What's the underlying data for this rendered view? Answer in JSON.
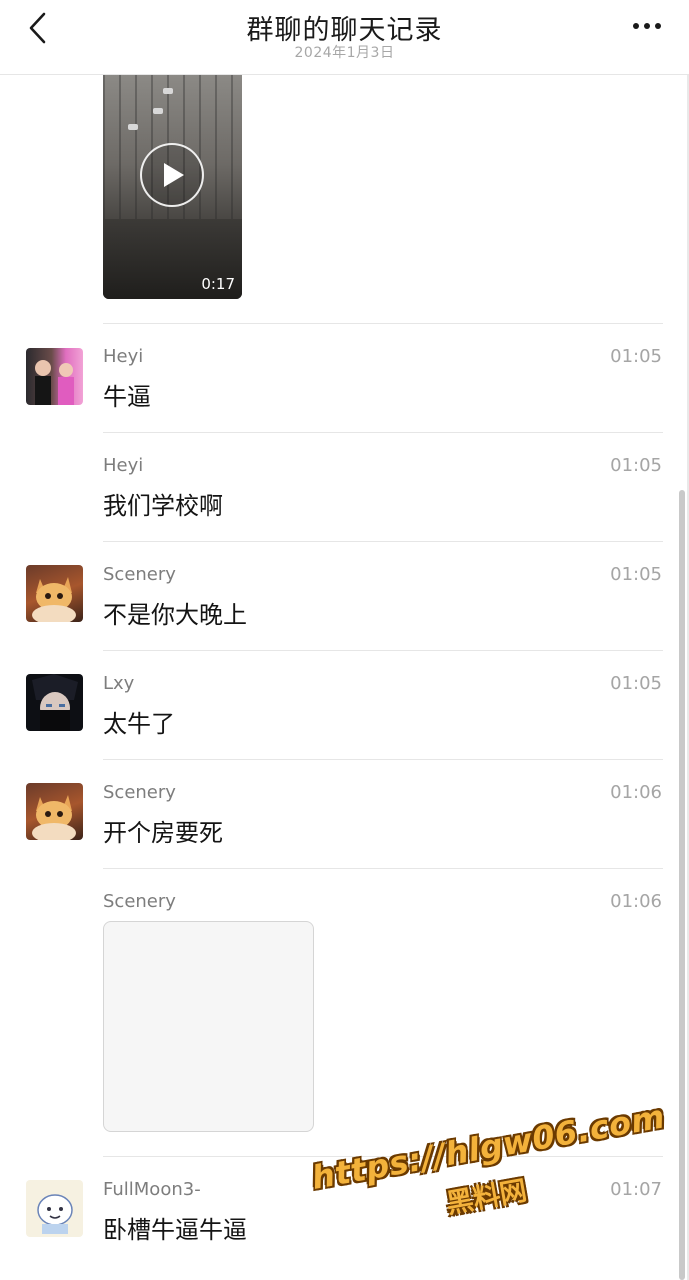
{
  "header": {
    "title": "群聊的聊天记录",
    "date": "2024年1月3日",
    "back_icon": "chevron-left-icon",
    "more_icon": "more-horizontal-icon"
  },
  "video": {
    "duration": "0:17",
    "play_icon": "play-icon"
  },
  "messages": [
    {
      "sender": "Heyi",
      "time": "01:05",
      "text": "牛逼",
      "avatar": "photo-two-people"
    },
    {
      "sender": "Heyi",
      "time": "01:05",
      "text": "我们学校啊"
    },
    {
      "sender": "Scenery",
      "time": "01:05",
      "text": "不是你大晚上",
      "avatar": "cat-photo"
    },
    {
      "sender": "Lxy",
      "time": "01:05",
      "text": "太牛了",
      "avatar": "anime-character"
    },
    {
      "sender": "Scenery",
      "time": "01:06",
      "text": "开个房要死",
      "avatar": "cat-photo"
    },
    {
      "sender": "Scenery",
      "time": "01:06",
      "image": "image-placeholder"
    },
    {
      "sender": "FullMoon3-",
      "time": "01:07",
      "text": "卧槽牛逼牛逼",
      "avatar": "cartoon-drawing"
    }
  ],
  "watermark": {
    "url": "https://hlgw06.com",
    "site": "黑料网",
    "color": "#f3b23b"
  }
}
